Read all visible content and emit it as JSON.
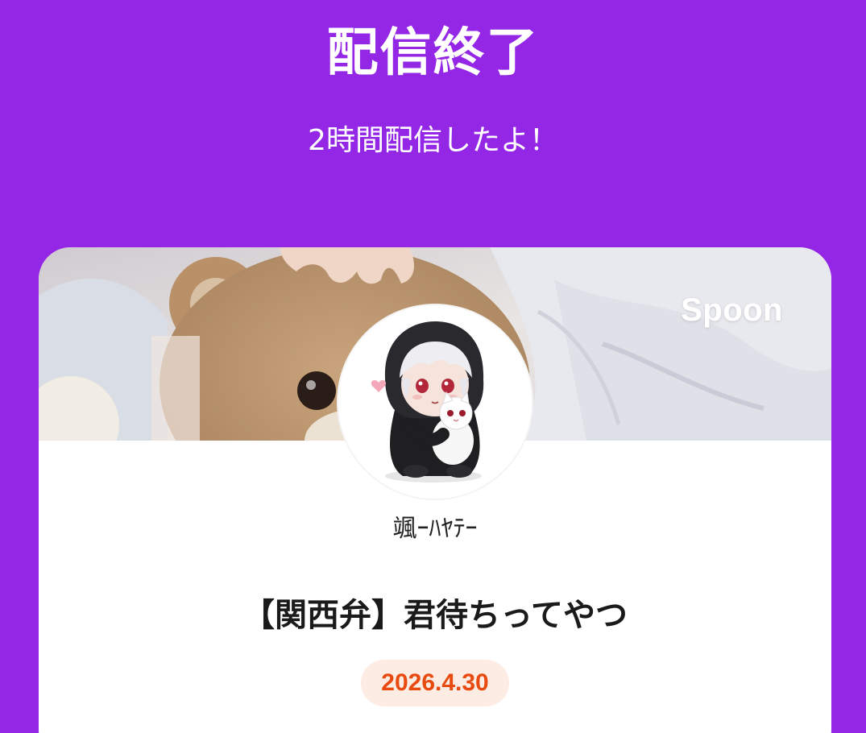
{
  "header": {
    "title": "配信終了",
    "subtitle": "2時間配信したよ！"
  },
  "card": {
    "brand": "Spoon",
    "username": "颯ｰﾊﾔﾃｰ",
    "live_title": "【関西弁】君待ちってやつ",
    "date": "2026.4.30"
  },
  "colors": {
    "background": "#9426e6",
    "card": "#ffffff",
    "date_text": "#e84a10",
    "date_badge": "#fdece3"
  }
}
